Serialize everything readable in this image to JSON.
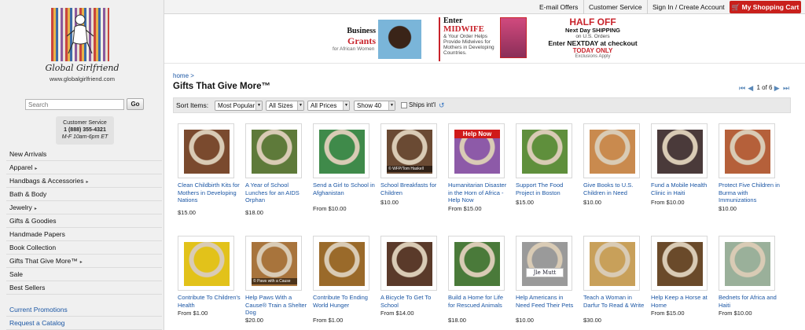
{
  "brand": {
    "logo_text": "Global Girlfriend",
    "url": "www.globalgirlfriend.com"
  },
  "search": {
    "placeholder": "Search",
    "button_label": "Go"
  },
  "customer_service": {
    "title": "Customer Service",
    "phone": "1 (888) 355-4321",
    "hours": "M-F 10am-6pm ET"
  },
  "sidebar": {
    "items": [
      {
        "label": "New Arrivals",
        "has_submenu": false
      },
      {
        "label": "Apparel",
        "has_submenu": true
      },
      {
        "label": "Handbags & Accessories",
        "has_submenu": true
      },
      {
        "label": "Bath & Body",
        "has_submenu": false
      },
      {
        "label": "Jewelry",
        "has_submenu": true
      },
      {
        "label": "Gifts & Goodies",
        "has_submenu": false
      },
      {
        "label": "Handmade Papers",
        "has_submenu": false
      },
      {
        "label": "Book Collection",
        "has_submenu": false
      },
      {
        "label": "Gifts That Give More™",
        "has_submenu": true
      },
      {
        "label": "Sale",
        "has_submenu": false
      },
      {
        "label": "Best Sellers",
        "has_submenu": false
      }
    ],
    "links": [
      "Current Promotions",
      "Request a Catalog"
    ],
    "submenu_arrow": "▸"
  },
  "topbar": {
    "email_offers": "E-mail Offers",
    "customer_service": "Customer Service",
    "sign_in": "Sign In / Create Account",
    "cart": "My Shopping Cart"
  },
  "banners": {
    "grants": {
      "line1": "Business",
      "line2": "Grants",
      "line3": "for African Women"
    },
    "midwife": {
      "line1": "Enter",
      "line2": "MIDWIFE",
      "line3": "& Your Order Helps Provide Midwives for Mothers in Developing Countries."
    },
    "shipping": {
      "line1": "HALF OFF",
      "line2": "Next Day SHIPPING",
      "line3": "on U.S. Orders",
      "line4": "Enter NEXTDAY at checkout",
      "line5": "TODAY ONLY",
      "line6": "Exclusions Apply"
    }
  },
  "breadcrumb": "home >",
  "page_title": "Gifts That Give More™",
  "pager": {
    "text": "1 of 6"
  },
  "filters": {
    "label": "Sort Items:",
    "sort": "Most Popular",
    "sizes": "All Sizes",
    "prices": "All Prices",
    "show": "Show 40",
    "ships_label": "Ships int'l"
  },
  "products": [
    {
      "name": "Clean Childbirth Kits for Mothers in Developing Nations",
      "price": "$15.00",
      "swatch": "#7a4a2e"
    },
    {
      "name": "A Year of School Lunches for an AIDS Orphan",
      "price": "$18.00",
      "swatch": "#5e7a3a"
    },
    {
      "name": "Send a Girl to School in Afghanistan",
      "price": "From $10.00",
      "swatch": "#3f8a4a"
    },
    {
      "name": "School Breakfasts for Children",
      "price": "$10.00",
      "swatch": "#6a4a33",
      "caption": "© WFP/Tom Haskell"
    },
    {
      "name": "Humanitarian Disaster in the Horn of Africa - Help Now",
      "price": "From $15.00",
      "swatch": "#8d5aa8",
      "badge": "Help Now"
    },
    {
      "name": "Support The Food Project in Boston",
      "price": "$15.00",
      "swatch": "#5f8f3c"
    },
    {
      "name": "Give Books to U.S. Children in Need",
      "price": "$10.00",
      "swatch": "#c98a4e"
    },
    {
      "name": "Fund a Mobile Health Clinic in Haiti",
      "price": "From $10.00",
      "swatch": "#4a3a3a"
    },
    {
      "name": "Protect Five Children in Burma with Immunizations",
      "price": "$10.00",
      "swatch": "#b5603a"
    },
    {
      "name": "Contribute To Children's Health",
      "price": "From $1.00",
      "swatch": "#e2c21a"
    },
    {
      "name": "Help Paws With a Cause® Train a Shelter Dog",
      "price": "$20.00",
      "swatch": "#a8743c",
      "caption": "© Paws with a Cause"
    },
    {
      "name": "Contribute To Ending World Hunger",
      "price": "From $1.00",
      "swatch": "#9a6a2a"
    },
    {
      "name": "A Bicycle To Get To School",
      "price": "From $14.00",
      "swatch": "#5a3a2a"
    },
    {
      "name": "Build a Home for Life for Rescued Animals",
      "price": "$18.00",
      "swatch": "#4a7a3a"
    },
    {
      "name": "Help Americans in Need Feed Their Pets",
      "price": "$10.00",
      "swatch": "#9a9a9a",
      "mug_text": "Jle Mutt"
    },
    {
      "name": "Teach a Woman in Darfur To Read & Write",
      "price": "$30.00",
      "swatch": "#c8a05a"
    },
    {
      "name": "Help Keep a Horse at Home",
      "price": "From $15.00",
      "swatch": "#6a4a2a"
    },
    {
      "name": "Bednets for Africa and Haiti",
      "price": "From $10.00",
      "swatch": "#9ab09a"
    }
  ],
  "colors": {
    "link": "#1b56a4",
    "cart": "#c9201c",
    "accent_red": "#c8232b"
  },
  "icons": [
    "search-icon",
    "cart-icon",
    "first-page-icon",
    "prev-page-icon",
    "next-page-icon",
    "last-page-icon",
    "refresh-icon"
  ]
}
